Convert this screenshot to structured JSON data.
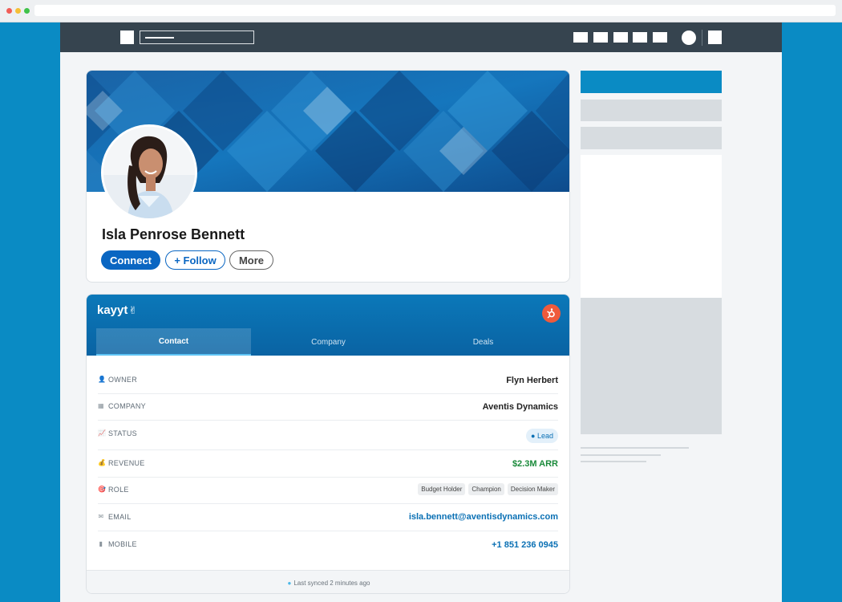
{
  "profile": {
    "name": "Isla Penrose Bennett",
    "connect_label": "Connect",
    "follow_label": "+ Follow",
    "more_label": "More"
  },
  "crm": {
    "brand": "kayyt",
    "tabs": [
      {
        "label": "Contact",
        "active": true
      },
      {
        "label": "Company",
        "active": false
      },
      {
        "label": "Deals",
        "active": false
      }
    ],
    "fields": {
      "owner": {
        "label": "OWNER",
        "value": "Flyn Herbert"
      },
      "company": {
        "label": "COMPANY",
        "value": "Aventis Dynamics"
      },
      "status": {
        "label": "STATUS",
        "value": "Lead"
      },
      "revenue": {
        "label": "REVENUE",
        "value": "$2.3M ARR"
      },
      "role": {
        "label": "ROLE",
        "values": [
          "Budget Holder",
          "Champion",
          "Decision Maker"
        ]
      },
      "email": {
        "label": "EMAIL",
        "value": "isla.bennett@aventisdynamics.com"
      },
      "mobile": {
        "label": "MOBILE",
        "value": "+1 851 236 0945"
      }
    },
    "sync_text": "Last synced 2 minutes ago"
  },
  "colors": {
    "page_bg": "#0a8bc4",
    "nav_bg": "#36444f",
    "brand_blue": "#0a66c2",
    "crm_header": "#0a6aaa",
    "hubspot": "#ef5a3c",
    "revenue_green": "#1a8a3a"
  },
  "icons": {
    "owner": "person-icon",
    "company": "building-icon",
    "status": "chart-icon",
    "revenue": "money-bag-icon",
    "role": "target-icon",
    "email": "envelope-icon",
    "mobile": "phone-icon",
    "integration": "hubspot-icon"
  }
}
